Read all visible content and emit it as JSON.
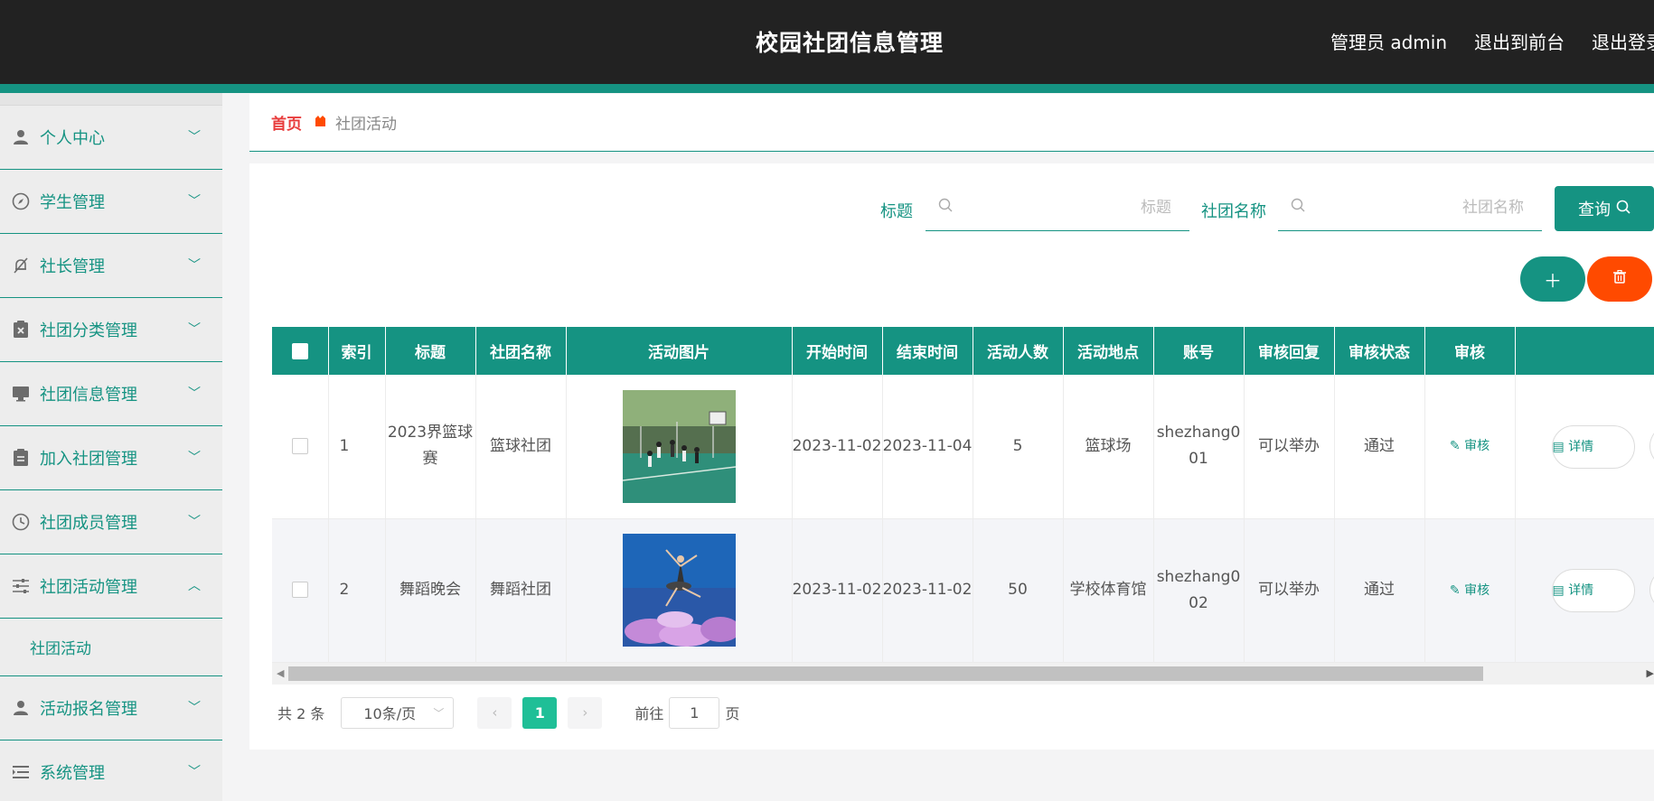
{
  "header": {
    "app_title": "校园社团信息管理",
    "user_label": "管理员 admin",
    "to_frontend": "退出到前台",
    "logout": "退出登录"
  },
  "sidebar": {
    "items": [
      {
        "label": "个人中心",
        "icon": "person-icon"
      },
      {
        "label": "学生管理",
        "icon": "compass-icon"
      },
      {
        "label": "社长管理",
        "icon": "bell-off-icon"
      },
      {
        "label": "社团分类管理",
        "icon": "clipboard-x-icon"
      },
      {
        "label": "社团信息管理",
        "icon": "monitor-icon"
      },
      {
        "label": "加入社团管理",
        "icon": "clipboard-icon"
      },
      {
        "label": "社团成员管理",
        "icon": "clock-icon"
      },
      {
        "label": "社团活动管理",
        "icon": "sliders-icon",
        "expanded": true,
        "children": [
          "社团活动"
        ]
      },
      {
        "label": "活动报名管理",
        "icon": "person-icon"
      },
      {
        "label": "系统管理",
        "icon": "list-icon"
      }
    ]
  },
  "breadcrumb": {
    "home": "首页",
    "current": "社团活动"
  },
  "search": {
    "title_label": "标题",
    "title_placeholder": "标题",
    "club_label": "社团名称",
    "club_placeholder": "社团名称",
    "query_button": "查询"
  },
  "table": {
    "columns": [
      "索引",
      "标题",
      "社团名称",
      "活动图片",
      "开始时间",
      "结束时间",
      "活动人数",
      "活动地点",
      "账号",
      "审核回复",
      "审核状态",
      "审核"
    ],
    "audit_link": "审核",
    "detail_button": "详情",
    "rows": [
      {
        "index": "1",
        "title": "2023界篮球赛",
        "club": "篮球社团",
        "image": "basketball-game-photo",
        "start": "2023-11-02",
        "end": "2023-11-04",
        "people": "5",
        "place": "篮球场",
        "account": "shezhang001",
        "reply": "可以举办",
        "status": "通过"
      },
      {
        "index": "2",
        "title": "舞蹈晚会",
        "club": "舞蹈社团",
        "image": "dance-performance-photo",
        "start": "2023-11-02",
        "end": "2023-11-02",
        "people": "50",
        "place": "学校体育馆",
        "account": "shezhang002",
        "reply": "可以举办",
        "status": "通过"
      }
    ]
  },
  "pagination": {
    "total": "共 2 条",
    "page_size": "10条/页",
    "current_page": "1",
    "goto_label": "前往",
    "goto_value": "1",
    "page_suffix": "页"
  },
  "colors": {
    "primary": "#159382",
    "danger": "#ff4a00",
    "header_bg": "#222222"
  }
}
